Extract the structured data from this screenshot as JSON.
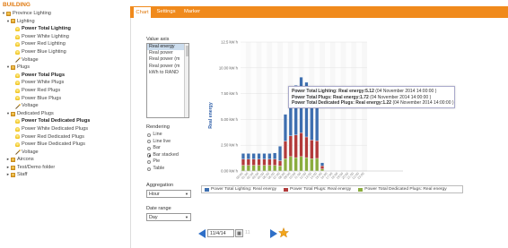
{
  "tree": {
    "title": "BUILDING",
    "nodes": [
      {
        "label": "Province Lighting",
        "icon": "folder",
        "depth": 0,
        "toggle": "▼",
        "bold": false
      },
      {
        "label": "Lighting",
        "icon": "folder",
        "depth": 1,
        "toggle": "▼",
        "bold": false
      },
      {
        "label": "Power Total Lighting",
        "icon": "bulb",
        "depth": 2,
        "toggle": "",
        "bold": true
      },
      {
        "label": "Power White Lighting",
        "icon": "bulb",
        "depth": 2,
        "toggle": "",
        "bold": false
      },
      {
        "label": "Power Red Lighting",
        "icon": "bulb",
        "depth": 2,
        "toggle": "",
        "bold": false
      },
      {
        "label": "Power Blue Lighting",
        "icon": "bulb",
        "depth": 2,
        "toggle": "",
        "bold": false
      },
      {
        "label": "Voltage",
        "icon": "wand",
        "depth": 2,
        "toggle": "",
        "bold": false
      },
      {
        "label": "Plugs",
        "icon": "folder",
        "depth": 1,
        "toggle": "▼",
        "bold": false
      },
      {
        "label": "Power Total Plugs",
        "icon": "bulb",
        "depth": 2,
        "toggle": "",
        "bold": true
      },
      {
        "label": "Power White Plugs",
        "icon": "bulb",
        "depth": 2,
        "toggle": "",
        "bold": false
      },
      {
        "label": "Power Red Plugs",
        "icon": "bulb",
        "depth": 2,
        "toggle": "",
        "bold": false
      },
      {
        "label": "Power Blue Plugs",
        "icon": "bulb",
        "depth": 2,
        "toggle": "",
        "bold": false
      },
      {
        "label": "Voltage",
        "icon": "wand",
        "depth": 2,
        "toggle": "",
        "bold": false
      },
      {
        "label": "Dedicated Plugs",
        "icon": "folder",
        "depth": 1,
        "toggle": "▼",
        "bold": false
      },
      {
        "label": "Power Total Dedicated Plugs",
        "icon": "bulb",
        "depth": 2,
        "toggle": "",
        "bold": true
      },
      {
        "label": "Power White Dedicated Plugs",
        "icon": "bulb",
        "depth": 2,
        "toggle": "",
        "bold": false
      },
      {
        "label": "Power Red Dedicated Plugs",
        "icon": "bulb",
        "depth": 2,
        "toggle": "",
        "bold": false
      },
      {
        "label": "Power Blue Dedicated Plugs",
        "icon": "bulb",
        "depth": 2,
        "toggle": "",
        "bold": false
      },
      {
        "label": "Voltage",
        "icon": "wand",
        "depth": 2,
        "toggle": "",
        "bold": false
      },
      {
        "label": "Aircons",
        "icon": "folder",
        "depth": 1,
        "toggle": "►",
        "bold": false
      },
      {
        "label": "Test/Demo folder",
        "icon": "folder",
        "depth": 1,
        "toggle": "►",
        "bold": false
      },
      {
        "label": "Staff",
        "icon": "folder",
        "depth": 1,
        "toggle": "►",
        "bold": false
      }
    ]
  },
  "tabs": [
    "Chart",
    "Settings",
    "Marker"
  ],
  "controls": {
    "value_axis_label": "Value axis",
    "value_axis_options": [
      "Real energy",
      "Real power",
      "Real power (m",
      "Real power (m",
      "kWh to RAND"
    ],
    "rendering_label": "Rendering",
    "rendering_options": [
      "Line",
      "Line live",
      "Bar",
      "Bar stacked",
      "Pie",
      "Table"
    ],
    "rendering_selected": "Bar stacked",
    "aggregation_label": "Aggregation",
    "aggregation_value": "Hour",
    "date_range_label": "Date range",
    "date_range_value": "Day"
  },
  "tooltip": {
    "lines": [
      {
        "series": "Power Total Lighting: Real energy:",
        "value": "5.12",
        "when": " (04 November 2014 14:00:00 )"
      },
      {
        "series": "Power Total Plugs: Real energy:",
        "value": "1.72",
        "when": " (04 November 2014 14:00:00 )"
      },
      {
        "series": "Power Total Dedicated Plugs: Real energy:",
        "value": "1.22",
        "when": " (04 November 2014 14:00:00 )"
      }
    ]
  },
  "nav": {
    "date": "11/4/14",
    "date_dim": "11"
  },
  "colors": {
    "accent": "#f08a1c",
    "lighting": "#3e6fb0",
    "plugs": "#b23a3a",
    "dedicated": "#8aac3e"
  },
  "chart_data": {
    "type": "bar",
    "stacked": true,
    "ylabel": "Real energy",
    "ylim": [
      0,
      12.5
    ],
    "yticks": [
      "0.00 kW h",
      "2.50 kW h",
      "5.00 kW h",
      "7.50 kW h",
      "10.00 kW h",
      "12.5 kW h"
    ],
    "ytick_values": [
      0,
      2.5,
      5,
      7.5,
      10,
      12.5
    ],
    "grid": true,
    "legend_position": "bottom",
    "categories": [
      "00:00",
      "01:00",
      "02:00",
      "03:00",
      "04:00",
      "05:00",
      "06:00",
      "07:00",
      "08:00",
      "09:00",
      "10:00",
      "11:00",
      "12:00",
      "13:00",
      "14:00",
      "15:00",
      "16:00",
      "17:00",
      "18:00",
      "19:00",
      "20:00",
      "21:00",
      "22:00",
      "23:00"
    ],
    "series": [
      {
        "name": "Power Total Lighting: Real energy",
        "color": "#3e6fb0",
        "values": [
          0.55,
          0.55,
          0.55,
          0.55,
          0.55,
          0.55,
          0.6,
          1.4,
          2.6,
          3.2,
          4.8,
          5.4,
          5.3,
          4.6,
          5.12,
          0.3,
          0,
          0,
          0,
          0,
          0,
          0,
          0,
          0
        ]
      },
      {
        "name": "Power Total Plugs: Real energy",
        "color": "#b23a3a",
        "values": [
          0.6,
          0.6,
          0.6,
          0.6,
          0.6,
          0.6,
          0.6,
          0.5,
          1.7,
          2.0,
          2.2,
          2.3,
          2.0,
          1.8,
          1.72,
          0.3,
          0,
          0,
          0,
          0,
          0,
          0,
          0,
          0
        ]
      },
      {
        "name": "Power Total Dedicated Plugs: Real energy",
        "color": "#8aac3e",
        "values": [
          0.55,
          0.55,
          0.55,
          0.55,
          0.55,
          0.55,
          0.55,
          0.5,
          1.2,
          1.4,
          1.3,
          1.4,
          1.3,
          1.2,
          1.22,
          0.2,
          0,
          0,
          0,
          0,
          0,
          0,
          0,
          0
        ]
      }
    ]
  }
}
